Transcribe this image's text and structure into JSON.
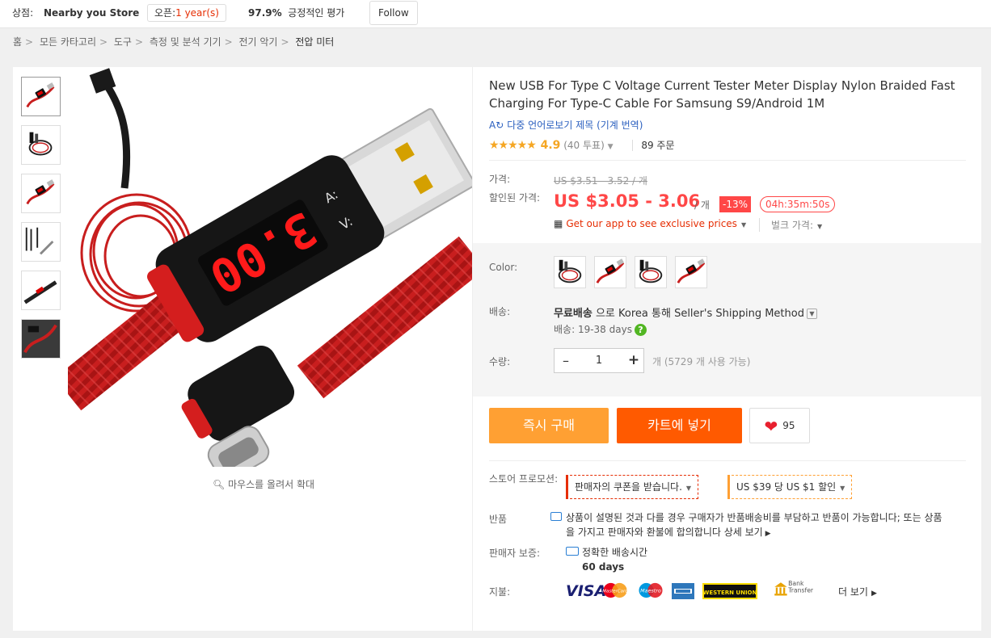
{
  "topbar": {
    "store_label": "상점:",
    "store_name": "Nearby you Store",
    "open_label": "오픈:",
    "open_value": "1 year(s)",
    "rating_pct": "97.9%",
    "rating_label": "긍정적인 평가",
    "follow": "Follow"
  },
  "breadcrumb": [
    "홈",
    "모든 카타고리",
    "도구",
    "측정 및 분석 기기",
    "전기 악기",
    "전압 미터"
  ],
  "gallery": {
    "zoom_hint": "마우스를 올려서 확대",
    "display_value": "3.00"
  },
  "product": {
    "title": "New USB For Type C Voltage Current Tester Meter Display Nylon Braided Fast Charging For Type-C Cable For Samsung S9/Android 1M",
    "translate": "다중 언어로보기 제목 (기계 번역)",
    "stars": "★★★★★",
    "score": "4.9",
    "votes": "(40 투표)",
    "orders": "89 주문",
    "price_label": "가격:",
    "original_price": "US $3.51 - 3.52 / 개",
    "sale_label": "할인된 가격:",
    "sale_price": "US $3.05 - 3.06",
    "per_unit": "/ 개",
    "discount": "-13%",
    "timer": "04h:35m:50s",
    "app_promo": "Get our app to see exclusive prices",
    "bulk": "벌크 가격:",
    "color_label": "Color:",
    "shipping_label": "배송:",
    "shipping_free": "무료배송",
    "shipping_text": " 으로 Korea 통해 Seller's Shipping Method",
    "shipping_days": "배송: 19-38 days",
    "qty_label": "수량:",
    "qty_value": "1",
    "qty_avail": "개 (5729 개 사용 가능)",
    "buy_now": "즉시 구매",
    "add_cart": "카트에 넣기",
    "wish_count": "95",
    "promo_label": "스토어 프로모션:",
    "coupon1": "판매자의 쿠폰을 받습니다.",
    "coupon2": "US $39 당 US $1 할인",
    "return_label": "반품",
    "return_text": "상품이 설명된 것과 다를 경우 구매자가 반품배송비를 부담하고 반품이 가능합니다; 또는 상품을 가지고 판매자와 환불에 합의합니다",
    "return_more": "상세 보기",
    "guarantee_label": "판매자 보증:",
    "guarantee_text": "정확한 배송시간",
    "guarantee_days": "60 days",
    "payment_label": "지불:",
    "visa": "VISA",
    "mastercard": "MasterCard",
    "maestro": "Maestro",
    "western_union": "WESTERN UNION",
    "bank_transfer": "Bank Transfer",
    "pay_more": "더 보기"
  },
  "colors": {
    "accent": "#ff4747",
    "buy": "#ffa033",
    "cart": "#ff5a00",
    "cable": "#cc1f1f",
    "link": "#2a5fbf"
  }
}
